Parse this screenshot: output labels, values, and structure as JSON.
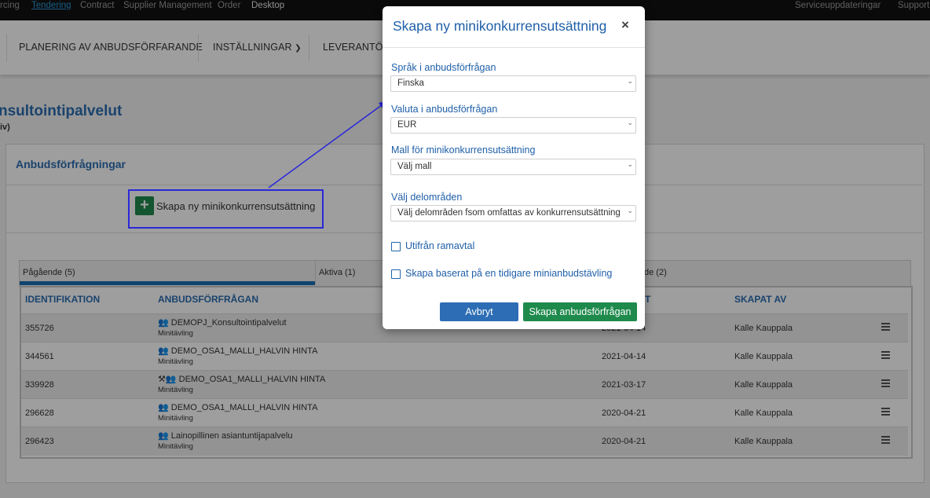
{
  "topbar": {
    "items": [
      "rcing",
      "Tendering",
      "Contract",
      "Supplier Management",
      "Order",
      "Desktop"
    ],
    "right": [
      "Serviceuppdateringar",
      "Support"
    ]
  },
  "subnav": {
    "planning": "PLANERING AV ANBUDSFÖRFARANDE",
    "settings": "INSTÄLLNINGAR",
    "suppliers": "LEVERANTÖRS"
  },
  "page": {
    "title": "nsultointipalvelut",
    "subtitle": "iv)"
  },
  "panel": {
    "title": "Anbudsförfrågningar",
    "create_label": "Skapa ny minikonkurrensutsättning"
  },
  "tabs": {
    "ongoing": "Pågående (5)",
    "active": "Aktiva (1)",
    "third": "de (2)"
  },
  "table": {
    "headers": [
      "IDENTIFIKATION",
      "ANBUDSFÖRFRÅGAN",
      "T",
      "SKAPAT AV"
    ],
    "rows": [
      {
        "id": "355726",
        "name": "DEMOPJ_Konsultointipalvelut",
        "type": "Minitävling",
        "date": "2021-04-14",
        "creator": "Kalle Kauppala"
      },
      {
        "id": "344561",
        "name": "DEMO_OSA1_MALLI_HALVIN HINTA",
        "type": "Minitävling",
        "date": "2021-04-14",
        "creator": "Kalle Kauppala"
      },
      {
        "id": "339928",
        "name": "DEMO_OSA1_MALLI_HALVIN HINTA",
        "type": "Minitävling",
        "date": "2021-03-17",
        "creator": "Kalle Kauppala"
      },
      {
        "id": "296628",
        "name": "DEMO_OSA1_MALLI_HALVIN HINTA",
        "type": "Minitävling",
        "date": "2020-04-21",
        "creator": "Kalle Kauppala"
      },
      {
        "id": "296423",
        "name": "Lainopillinen asiantuntijapalvelu",
        "type": "Minitävling",
        "date": "2020-04-21",
        "creator": "Kalle Kauppala"
      }
    ]
  },
  "modal": {
    "title": "Skapa ny minikonkurrensutsättning",
    "close": "×",
    "language_label": "Språk i anbudsförfrågan",
    "language_value": "Finska",
    "currency_label": "Valuta i anbudsförfrågan",
    "currency_value": "EUR",
    "template_label": "Mall för minikonkurrensutsättning",
    "template_value": "Välj mall",
    "subareas_label": "Välj delområden",
    "subareas_value": "Välj delområden fsom omfattas av konkurrensutsättning",
    "framework_label": "Utifrån ramavtal",
    "previous_label": "Skapa baserat på en tidigare minianbudstävling",
    "cancel": "Avbryt",
    "create": "Skapa anbudsförfrågan"
  },
  "colors": {
    "accent_blue": "#1f5fa8",
    "green": "#1e8a4c",
    "highlight": "#2a28d8"
  }
}
